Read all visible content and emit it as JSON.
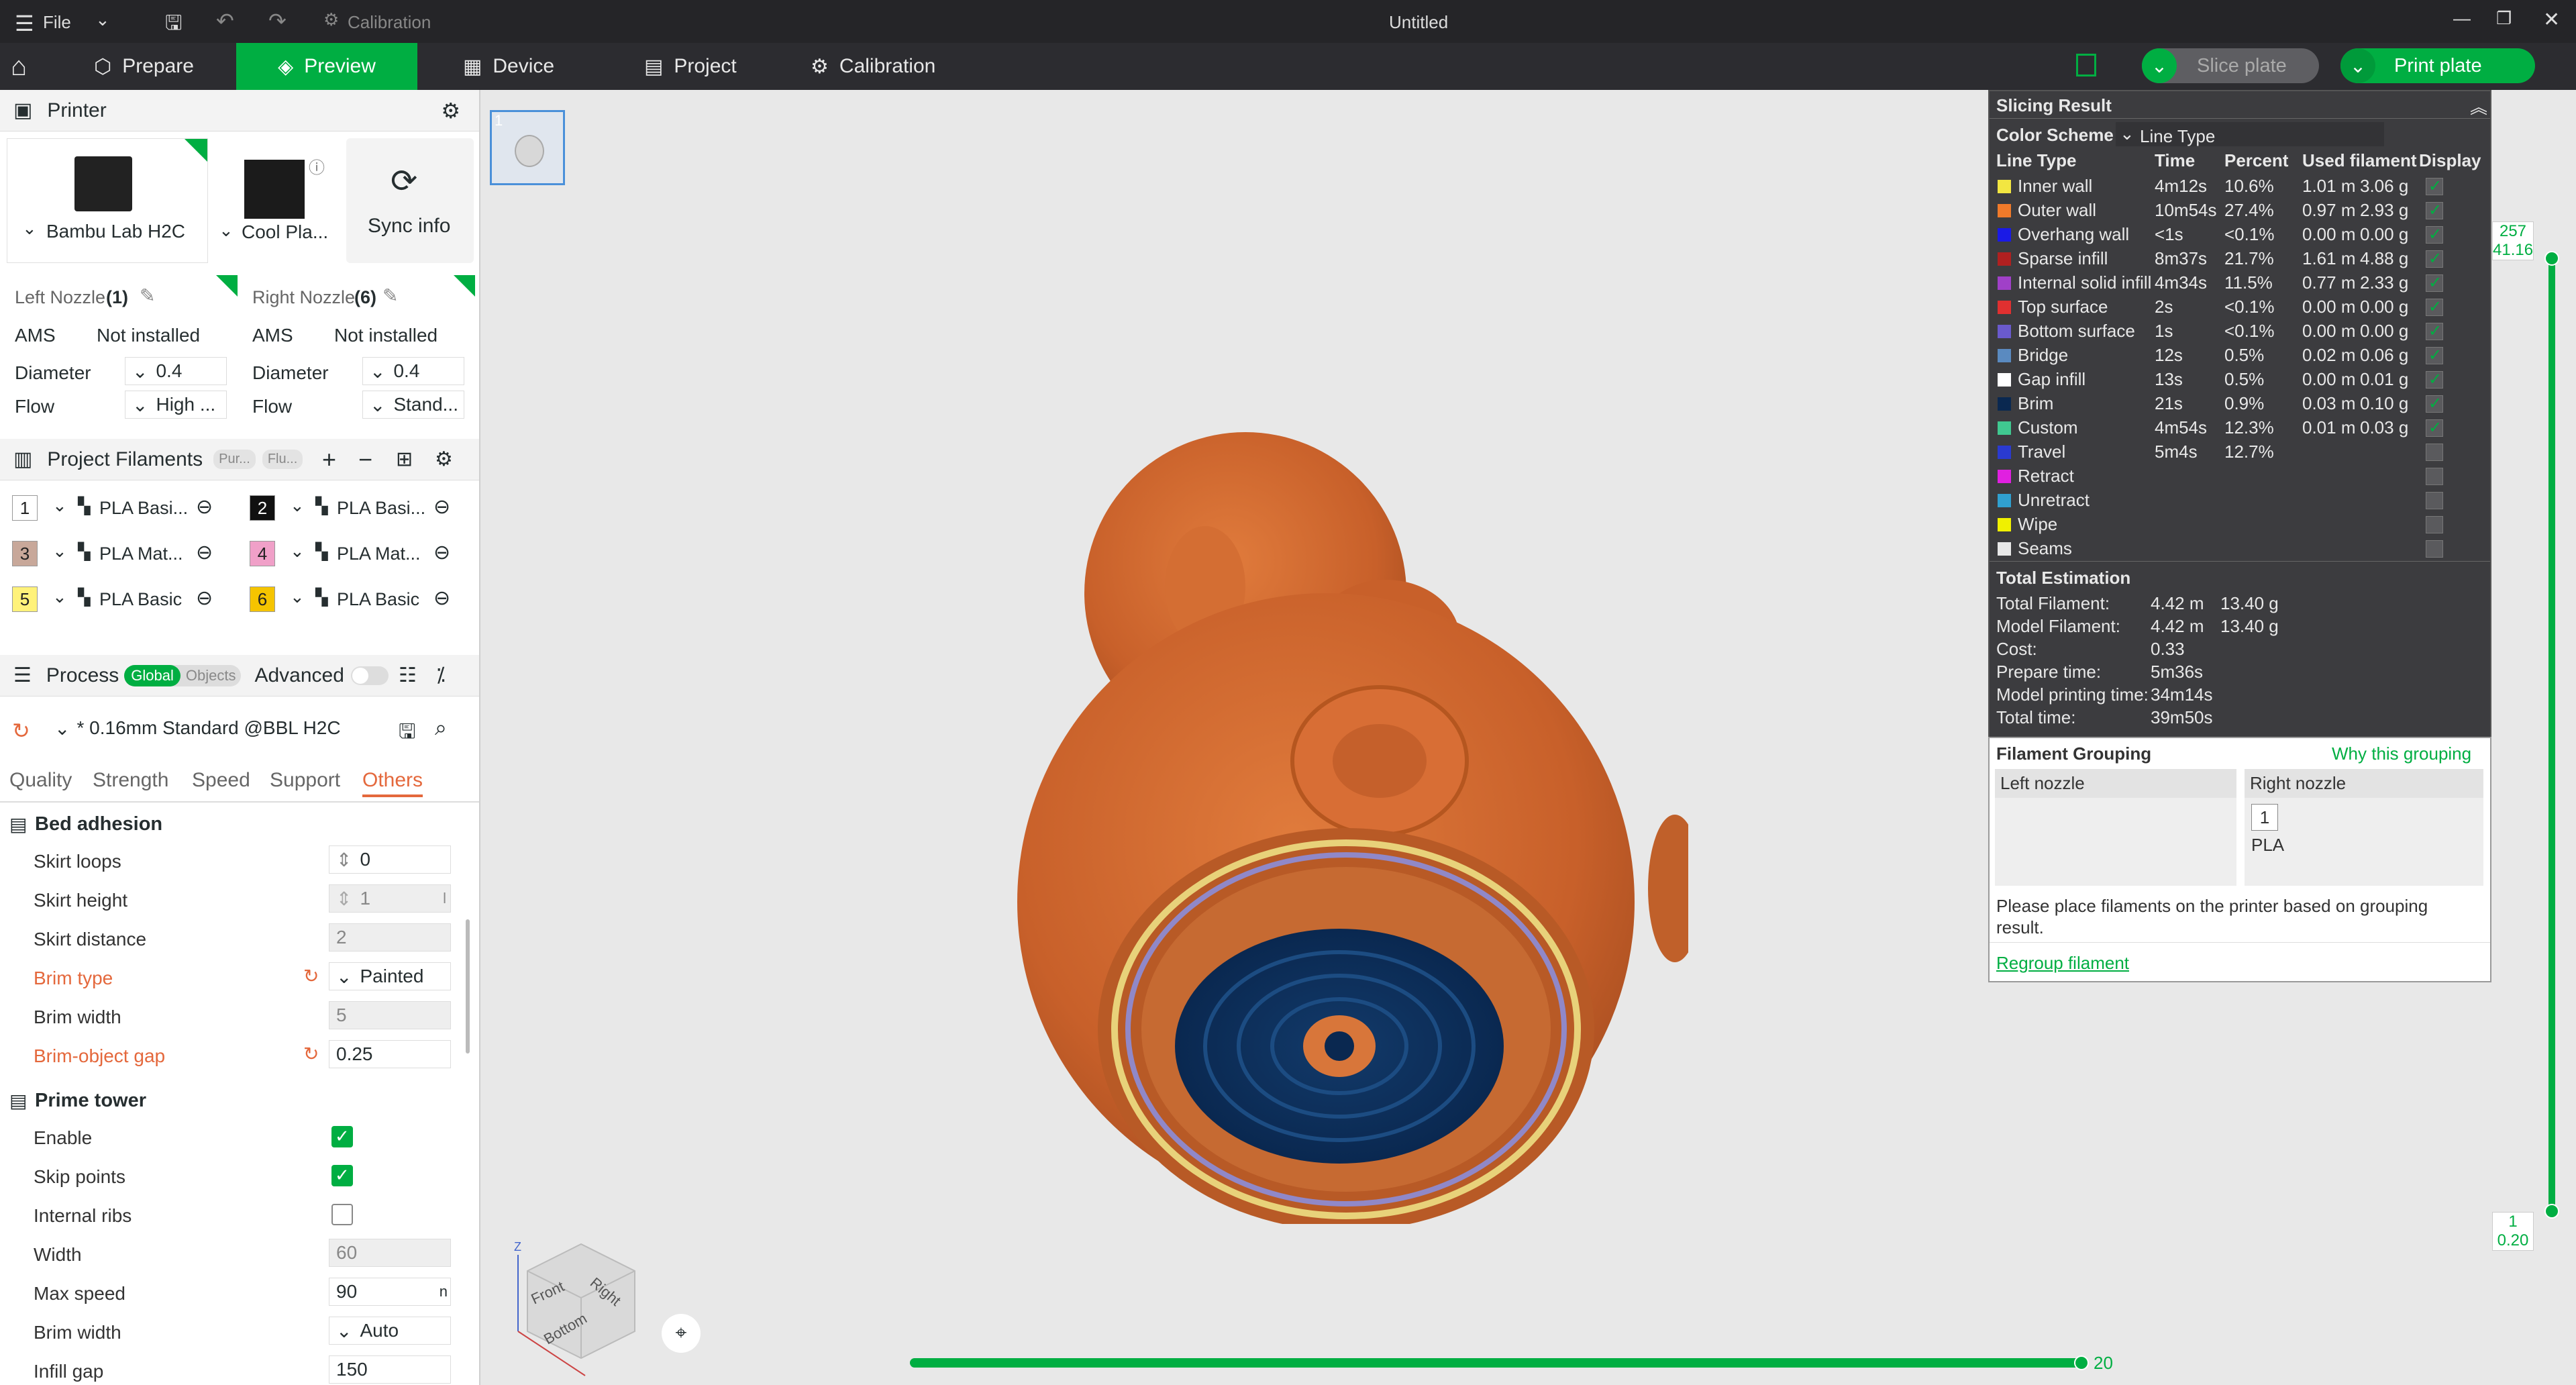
{
  "titlebar": {
    "file": "File",
    "calibration": "Calibration",
    "title": "Untitled"
  },
  "tabs": {
    "prepare": "Prepare",
    "preview": "Preview",
    "device": "Device",
    "project": "Project",
    "calibration": "Calibration"
  },
  "actions": {
    "slice_plate": "Slice plate",
    "print_plate": "Print plate"
  },
  "printer": {
    "header": "Printer",
    "name": "Bambu Lab H2C",
    "plate": "Cool Pla...",
    "sync": "Sync info",
    "left_nozzle": {
      "title": "Left Nozzle",
      "count": "(1)",
      "ams": "AMS",
      "ams_val": "Not installed",
      "diameter": "Diameter",
      "diameter_val": "0.4",
      "flow": "Flow",
      "flow_val": "High ..."
    },
    "right_nozzle": {
      "title": "Right Nozzle",
      "count": "(6)",
      "ams": "AMS",
      "ams_val": "Not installed",
      "diameter": "Diameter",
      "diameter_val": "0.4",
      "flow": "Flow",
      "flow_val": "Stand..."
    }
  },
  "filaments": {
    "header": "Project Filaments",
    "chip1": "Pur...",
    "chip2": "Flu...",
    "items": [
      {
        "num": "1",
        "name": "PLA Basi...",
        "color": "#ffffff",
        "text": "#222222"
      },
      {
        "num": "2",
        "name": "PLA Basi...",
        "color": "#111111",
        "text": "#ffffff"
      },
      {
        "num": "3",
        "name": "PLA Mat...",
        "color": "#c8a89a",
        "text": "#222222"
      },
      {
        "num": "4",
        "name": "PLA Mat...",
        "color": "#f0a0c8",
        "text": "#222222"
      },
      {
        "num": "5",
        "name": "PLA Basic",
        "color": "#fff27a",
        "text": "#222222"
      },
      {
        "num": "6",
        "name": "PLA Basic",
        "color": "#f5c400",
        "text": "#222222"
      }
    ]
  },
  "process": {
    "header": "Process",
    "global": "Global",
    "objects": "Objects",
    "advanced": "Advanced",
    "preset": "* 0.16mm Standard @BBL H2C",
    "tabs": [
      "Quality",
      "Strength",
      "Speed",
      "Support",
      "Others"
    ],
    "bed_adhesion": "Bed adhesion",
    "skirt_loops": "Skirt loops",
    "skirt_loops_val": "0",
    "skirt_height": "Skirt height",
    "skirt_height_val": "1",
    "skirt_height_unit": "l",
    "skirt_distance": "Skirt distance",
    "skirt_distance_val": "2",
    "brim_type": "Brim type",
    "brim_type_val": "Painted",
    "brim_width": "Brim width",
    "brim_width_val": "5",
    "brim_gap": "Brim-object gap",
    "brim_gap_val": "0.25",
    "prime_tower": "Prime tower",
    "enable": "Enable",
    "skip_points": "Skip points",
    "internal_ribs": "Internal ribs",
    "width": "Width",
    "width_val": "60",
    "max_speed": "Max speed",
    "max_speed_val": "90",
    "max_speed_unit": "n",
    "pt_brim_width": "Brim width",
    "pt_brim_width_val": "Auto",
    "infill_gap": "Infill gap",
    "infill_gap_val": "150"
  },
  "slicing": {
    "title": "Slicing Result",
    "color_scheme": "Color Scheme",
    "scheme_val": "Line Type",
    "columns": [
      "Line Type",
      "Time",
      "Percent",
      "Used filament",
      "Display"
    ],
    "rows": [
      {
        "name": "Inner wall",
        "color": "#f2e641",
        "time": "4m12s",
        "pct": "10.6%",
        "m": "1.01 m",
        "g": "3.06 g",
        "on": true
      },
      {
        "name": "Outer wall",
        "color": "#f07a2a",
        "time": "10m54s",
        "pct": "27.4%",
        "m": "0.97 m",
        "g": "2.93 g",
        "on": true
      },
      {
        "name": "Overhang wall",
        "color": "#1a1ae6",
        "time": "<1s",
        "pct": "<0.1%",
        "m": "0.00 m",
        "g": "0.00 g",
        "on": true
      },
      {
        "name": "Sparse infill",
        "color": "#b02020",
        "time": "8m37s",
        "pct": "21.7%",
        "m": "1.61 m",
        "g": "4.88 g",
        "on": true
      },
      {
        "name": "Internal solid infill",
        "color": "#a040c8",
        "time": "4m34s",
        "pct": "11.5%",
        "m": "0.77 m",
        "g": "2.33 g",
        "on": true
      },
      {
        "name": "Top surface",
        "color": "#e03030",
        "time": "2s",
        "pct": "<0.1%",
        "m": "0.00 m",
        "g": "0.00 g",
        "on": true
      },
      {
        "name": "Bottom surface",
        "color": "#6a5acd",
        "time": "1s",
        "pct": "<0.1%",
        "m": "0.00 m",
        "g": "0.00 g",
        "on": true
      },
      {
        "name": "Bridge",
        "color": "#5a8ac0",
        "time": "12s",
        "pct": "0.5%",
        "m": "0.02 m",
        "g": "0.06 g",
        "on": true
      },
      {
        "name": "Gap infill",
        "color": "#ffffff",
        "time": "13s",
        "pct": "0.5%",
        "m": "0.00 m",
        "g": "0.01 g",
        "on": true
      },
      {
        "name": "Brim",
        "color": "#0a2850",
        "time": "21s",
        "pct": "0.9%",
        "m": "0.03 m",
        "g": "0.10 g",
        "on": true
      },
      {
        "name": "Custom",
        "color": "#40c890",
        "time": "4m54s",
        "pct": "12.3%",
        "m": "0.01 m",
        "g": "0.03 g",
        "on": true
      },
      {
        "name": "Travel",
        "color": "#2a3ad0",
        "time": "5m4s",
        "pct": "12.7%",
        "m": "",
        "g": "",
        "on": false
      },
      {
        "name": "Retract",
        "color": "#e020e0",
        "time": "",
        "pct": "",
        "m": "",
        "g": "",
        "on": false
      },
      {
        "name": "Unretract",
        "color": "#30a0d0",
        "time": "",
        "pct": "",
        "m": "",
        "g": "",
        "on": false
      },
      {
        "name": "Wipe",
        "color": "#f0f000",
        "time": "",
        "pct": "",
        "m": "",
        "g": "",
        "on": false
      },
      {
        "name": "Seams",
        "color": "#e8e8e8",
        "time": "",
        "pct": "",
        "m": "",
        "g": "",
        "on": false
      }
    ],
    "total_estimation": "Total Estimation",
    "totals": [
      {
        "label": "Total Filament:",
        "v1": "4.42 m",
        "v2": "13.40 g"
      },
      {
        "label": "Model Filament:",
        "v1": "4.42 m",
        "v2": "13.40 g"
      },
      {
        "label": "Cost:",
        "v1": "0.33",
        "v2": ""
      },
      {
        "label": "Prepare time:",
        "v1": "5m36s",
        "v2": ""
      },
      {
        "label": "Model printing time:",
        "v1": "34m14s",
        "v2": ""
      },
      {
        "label": "Total time:",
        "v1": "39m50s",
        "v2": ""
      }
    ]
  },
  "grouping": {
    "title": "Filament Grouping",
    "why": "Why this grouping",
    "left": "Left nozzle",
    "right": "Right nozzle",
    "slot": "1",
    "material": "PLA",
    "note": "Please place filaments on the printer based on grouping result.",
    "regroup": "Regroup filament"
  },
  "plate": {
    "thumb_num": "1"
  },
  "layers": {
    "top_layer": "257",
    "top_height": "41.16",
    "bottom_layer": "1",
    "bottom_height": "0.20",
    "progress": 1.0,
    "move_value": "20"
  },
  "navcube": {
    "front": "Front",
    "right": "Right",
    "bottom": "Bottom",
    "z": "Z"
  }
}
